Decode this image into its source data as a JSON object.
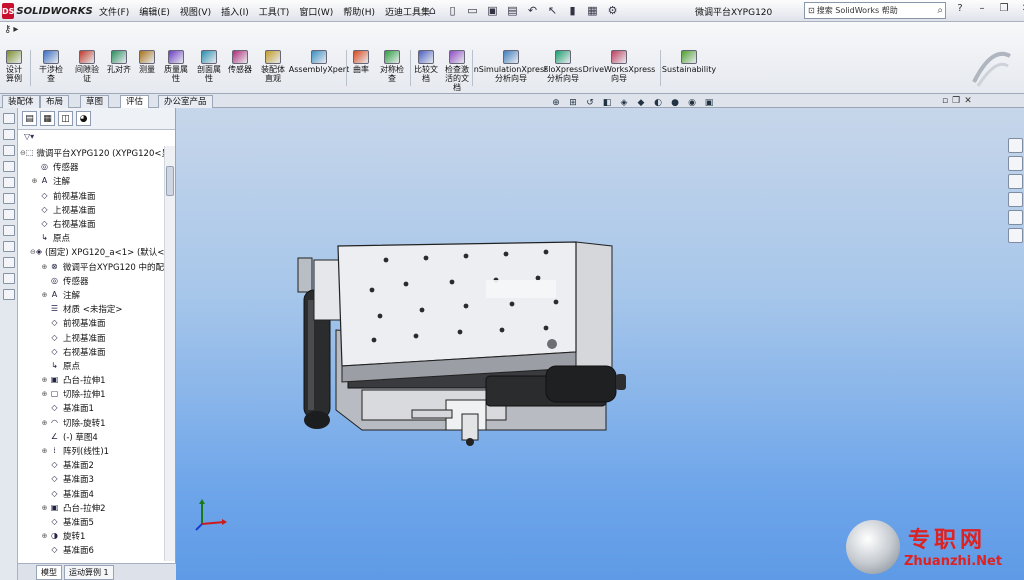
{
  "app": {
    "name": "SOLIDWORKS",
    "logo_badge": "DS",
    "document_title": "微调平台XYPG120"
  },
  "menu": [
    "文件(F)",
    "编辑(E)",
    "视图(V)",
    "插入(I)",
    "工具(T)",
    "窗口(W)",
    "帮助(H)",
    "迈迪工具集"
  ],
  "help_search": {
    "placeholder": "搜索 SolidWorks 帮助"
  },
  "commands": [
    {
      "label": "设计算例",
      "icon": "design-study-icon"
    },
    {
      "label": "干涉检查",
      "icon": "interference-icon"
    },
    {
      "label": "间隙验证",
      "icon": "clearance-icon"
    },
    {
      "label": "孔对齐",
      "icon": "hole-align-icon"
    },
    {
      "label": "测量",
      "icon": "measure-icon"
    },
    {
      "label": "质量属性",
      "icon": "mass-props-icon"
    },
    {
      "label": "剖面属性",
      "icon": "section-props-icon"
    },
    {
      "label": "传感器",
      "icon": "sensor-icon"
    },
    {
      "label": "装配体直观",
      "icon": "assembly-visual-icon"
    },
    {
      "label": "AssemblyXpert",
      "icon": "assemblyxpert-icon"
    },
    {
      "label": "曲率",
      "icon": "curvature-icon"
    },
    {
      "label": "对称检查",
      "icon": "symmetry-icon"
    },
    {
      "label": "比较文档",
      "icon": "compare-icon"
    },
    {
      "label": "检查激活的文档",
      "icon": "check-doc-icon"
    },
    {
      "label": "nSimulationXpress分析向导",
      "icon": "simxpress-icon"
    },
    {
      "label": "FloXpress分析向导",
      "icon": "floxpress-icon"
    },
    {
      "label": "DriveWorksXpress向导",
      "icon": "driveworks-icon"
    },
    {
      "label": "Sustainability",
      "icon": "sustainability-icon"
    }
  ],
  "tabs": [
    "装配体",
    "布局",
    "草图",
    "评估",
    "办公室产品"
  ],
  "active_tab": "评估",
  "tree": [
    {
      "label": "微调平台XYPG120  (XYPG120<显",
      "level": 0,
      "icon": "assembly-icon",
      "exp": "⊖"
    },
    {
      "label": "传感器",
      "level": 1,
      "icon": "sensor-icon",
      "exp": ""
    },
    {
      "label": "注解",
      "level": 1,
      "icon": "annotation-icon",
      "exp": "⊕"
    },
    {
      "label": "前视基准面",
      "level": 1,
      "icon": "plane-icon",
      "exp": ""
    },
    {
      "label": "上视基准面",
      "level": 1,
      "icon": "plane-icon",
      "exp": ""
    },
    {
      "label": "右视基准面",
      "level": 1,
      "icon": "plane-icon",
      "exp": ""
    },
    {
      "label": "原点",
      "level": 1,
      "icon": "origin-icon",
      "exp": ""
    },
    {
      "label": "(固定) XPG120_a<1> (默认<",
      "level": 1,
      "icon": "part-icon",
      "exp": "⊖"
    },
    {
      "label": "微调平台XYPG120 中的配",
      "level": 2,
      "icon": "mates-icon",
      "exp": "⊕"
    },
    {
      "label": "传感器",
      "level": 2,
      "icon": "sensor-icon",
      "exp": ""
    },
    {
      "label": "注解",
      "level": 2,
      "icon": "annotation-icon",
      "exp": "⊕"
    },
    {
      "label": "材质 <未指定>",
      "level": 2,
      "icon": "material-icon",
      "exp": ""
    },
    {
      "label": "前视基准面",
      "level": 2,
      "icon": "plane-icon",
      "exp": ""
    },
    {
      "label": "上视基准面",
      "level": 2,
      "icon": "plane-icon",
      "exp": ""
    },
    {
      "label": "右视基准面",
      "level": 2,
      "icon": "plane-icon",
      "exp": ""
    },
    {
      "label": "原点",
      "level": 2,
      "icon": "origin-icon",
      "exp": ""
    },
    {
      "label": "凸台-拉伸1",
      "level": 2,
      "icon": "extrude-icon",
      "exp": "⊕"
    },
    {
      "label": "切除-拉伸1",
      "level": 2,
      "icon": "cut-icon",
      "exp": "⊕"
    },
    {
      "label": "基准面1",
      "level": 2,
      "icon": "plane-icon",
      "exp": ""
    },
    {
      "label": "切除-旋转1",
      "level": 2,
      "icon": "revolve-cut-icon",
      "exp": "⊕"
    },
    {
      "label": "(-) 草图4",
      "level": 2,
      "icon": "sketch-icon",
      "exp": ""
    },
    {
      "label": "阵列(线性)1",
      "level": 2,
      "icon": "pattern-icon",
      "exp": "⊕"
    },
    {
      "label": "基准面2",
      "level": 2,
      "icon": "plane-icon",
      "exp": ""
    },
    {
      "label": "基准面3",
      "level": 2,
      "icon": "plane-icon",
      "exp": ""
    },
    {
      "label": "基准面4",
      "level": 2,
      "icon": "plane-icon",
      "exp": ""
    },
    {
      "label": "凸台-拉伸2",
      "level": 2,
      "icon": "extrude-icon",
      "exp": "⊕"
    },
    {
      "label": "基准面5",
      "level": 2,
      "icon": "plane-icon",
      "exp": ""
    },
    {
      "label": "旋转1",
      "level": 2,
      "icon": "revolve-icon",
      "exp": "⊕"
    },
    {
      "label": "基准面6",
      "level": 2,
      "icon": "plane-icon",
      "exp": ""
    }
  ],
  "bottom_tabs": [
    "模型",
    "运动算例 1"
  ],
  "watermark": {
    "cn": "专职网",
    "url": "Zhuanzhi.Net"
  },
  "colors": {
    "accent": "#c8102e",
    "viewport_top": "#c7d6ea",
    "viewport_bottom": "#5e9ae6"
  }
}
